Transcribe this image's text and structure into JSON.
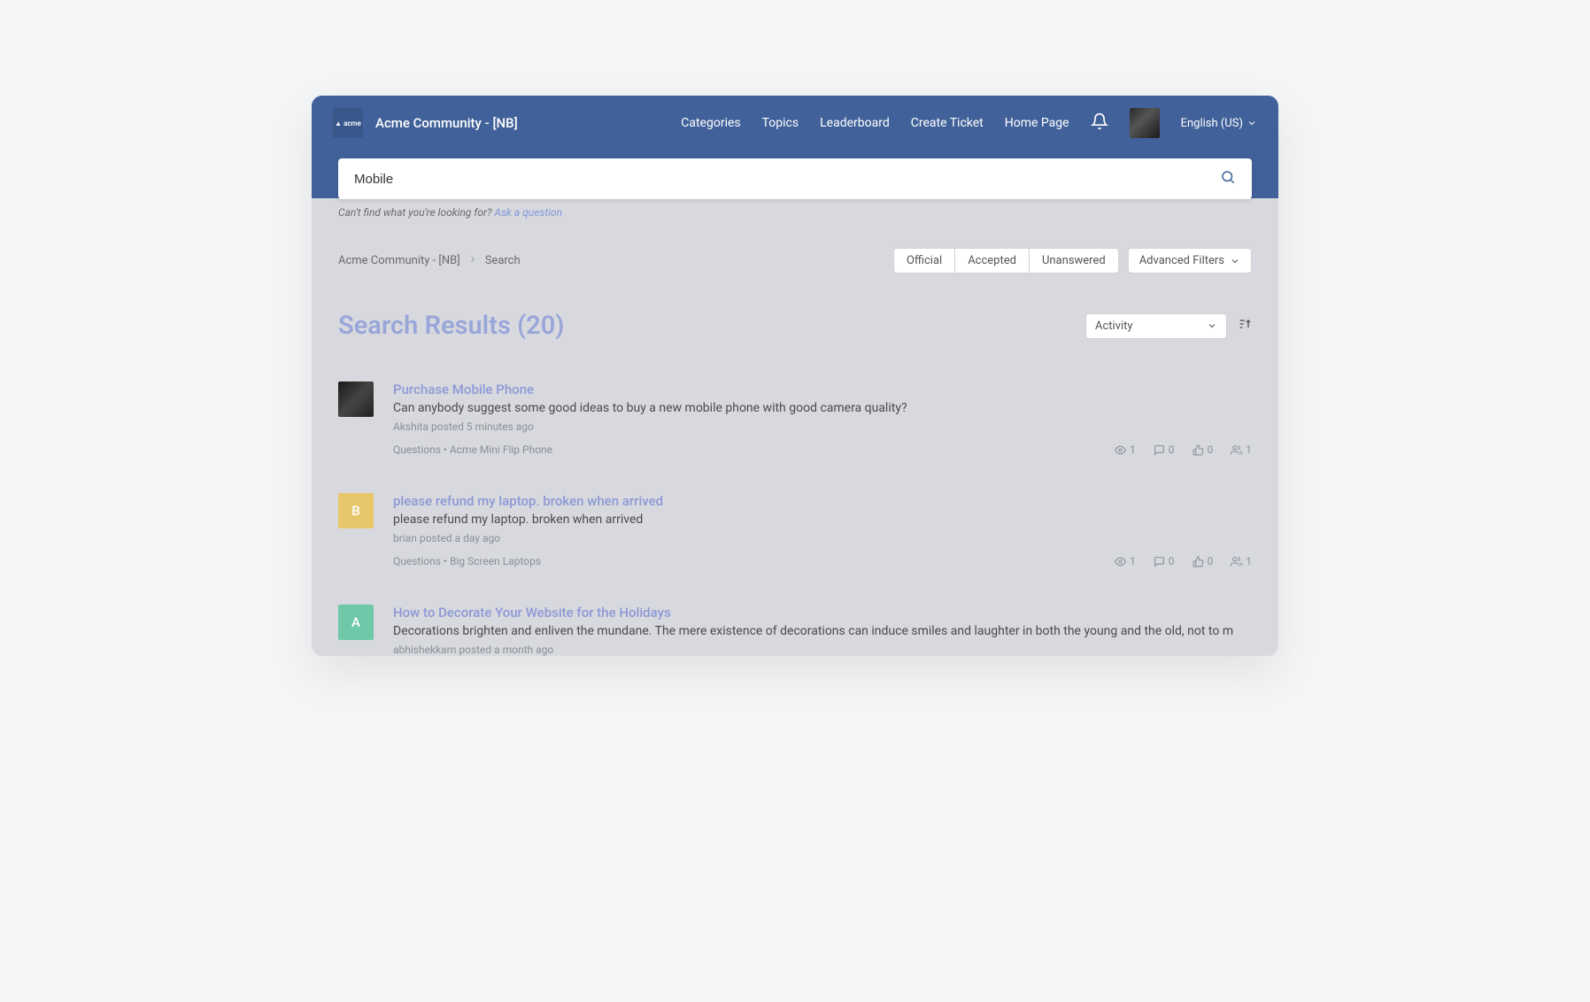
{
  "header": {
    "logo_text": "▲ acme",
    "site_title": "Acme Community - [NB]",
    "nav": {
      "categories": "Categories",
      "topics": "Topics",
      "leaderboard": "Leaderboard",
      "create_ticket": "Create Ticket",
      "home_page": "Home Page"
    },
    "language": "English (US)"
  },
  "search": {
    "value": "Mobile",
    "hint_prefix": "Can't find what you're looking for? ",
    "hint_link": "Ask a question"
  },
  "breadcrumb": {
    "root": "Acme Community - [NB]",
    "current": "Search"
  },
  "filters": {
    "official": "Official",
    "accepted": "Accepted",
    "unanswered": "Unanswered",
    "advanced": "Advanced Filters"
  },
  "page_title": "Search Results (20)",
  "sort": {
    "selected": "Activity"
  },
  "results": [
    {
      "avatar": {
        "type": "img",
        "letter": "",
        "bg": ""
      },
      "title": "Purchase Mobile Phone",
      "snippet": "Can anybody suggest some good ideas to buy a new mobile phone with good camera quality?",
      "meta": "Akshita posted 5 minutes ago",
      "category": "Questions • Acme Mini Flip Phone",
      "stats": {
        "views": "1",
        "comments": "0",
        "likes": "0",
        "users": "1"
      }
    },
    {
      "avatar": {
        "type": "letter",
        "letter": "B",
        "bg": "#e8c76a"
      },
      "title": "please refund my laptop. broken when arrived",
      "snippet": "please refund my laptop. broken when arrived",
      "meta": "brian posted a day ago",
      "category": "Questions • Big Screen Laptops",
      "stats": {
        "views": "1",
        "comments": "0",
        "likes": "0",
        "users": "1"
      }
    },
    {
      "avatar": {
        "type": "letter",
        "letter": "A",
        "bg": "#6fc9a8"
      },
      "title": "How to Decorate Your Website for the Holidays",
      "snippet": "Decorations brighten and enliven the mundane. The mere existence of decorations can induce smiles and laughter in both the young and the old, not to m",
      "meta": "abhishekkarn posted a month ago",
      "category": "",
      "stats": null
    }
  ]
}
